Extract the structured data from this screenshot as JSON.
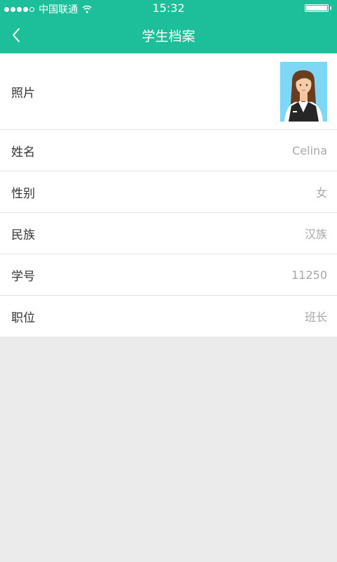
{
  "status_bar": {
    "carrier": "中国联通",
    "time": "15:32"
  },
  "nav": {
    "title": "学生档案"
  },
  "profile": {
    "photo_label": "照片",
    "fields": [
      {
        "label": "姓名",
        "value": "Celina"
      },
      {
        "label": "性别",
        "value": "女"
      },
      {
        "label": "民族",
        "value": "汉族"
      },
      {
        "label": "学号",
        "value": "11250"
      },
      {
        "label": "职位",
        "value": "班长"
      }
    ]
  },
  "colors": {
    "accent": "#1dbf9a",
    "background": "#ebebeb",
    "value_text": "#a8a8a8"
  }
}
